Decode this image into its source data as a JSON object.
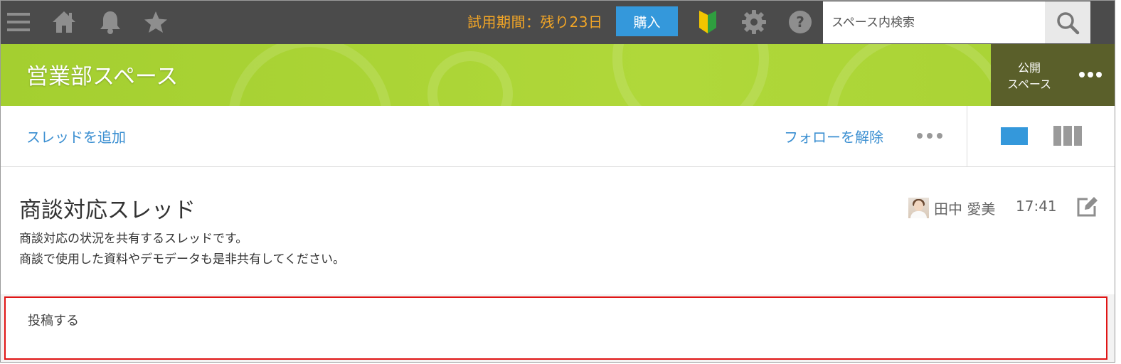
{
  "topbar": {
    "icons": [
      "menu-icon",
      "home-icon",
      "bell-icon",
      "star-icon",
      "beginner-icon",
      "gear-icon",
      "help-icon",
      "search-icon"
    ],
    "trial_text": "試用期間：残り23日",
    "buy_label": "購入",
    "search_placeholder": "スペース内検索",
    "colors": {
      "bar": "#4b4b4b",
      "trial": "#f3a626",
      "buy": "#3498db"
    }
  },
  "space": {
    "title": "営業部スペース",
    "public_label_line1": "公開",
    "public_label_line2": "スペース",
    "colors": {
      "header": "#a8d234",
      "public_box": "#5a5f2a"
    }
  },
  "actions": {
    "add_thread": "スレッドを追加",
    "unfollow": "フォローを解除",
    "view_modes": [
      "single-view-icon",
      "column-view-icon"
    ],
    "link_color": "#3b8fd1"
  },
  "thread": {
    "title": "商談対応スレッド",
    "description_line1": "商談対応の状況を共有するスレッドです。",
    "description_line2": "商談で使用した資料やデモデータも是非共有してください。",
    "author": "田中 愛美",
    "time": "17:41"
  },
  "post": {
    "label": "投稿する",
    "highlight_color": "#e01515"
  }
}
